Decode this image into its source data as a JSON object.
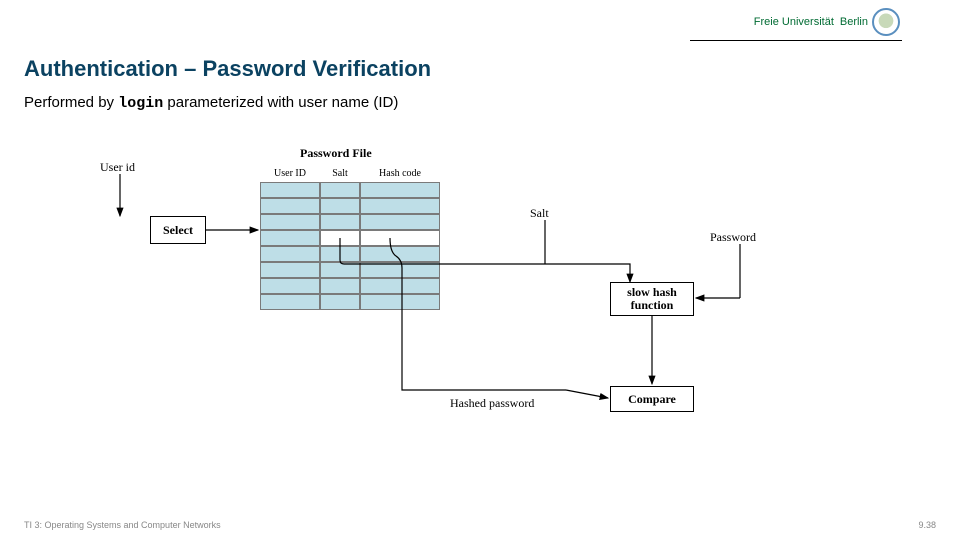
{
  "header": {
    "uni_line1": "Freie Universität",
    "uni_line2": "Berlin"
  },
  "title": "Authentication – Password Verification",
  "subtitle": {
    "pre": "Performed by ",
    "code": "login",
    "post": " parameterized with user name (ID)"
  },
  "diagram": {
    "labels": {
      "password_file": "Password File",
      "user_id": "User id",
      "col_user_id": "User ID",
      "col_salt": "Salt",
      "col_hash": "Hash code",
      "select": "Select",
      "salt": "Salt",
      "password": "Password",
      "slow_hash": "slow hash function",
      "hashed_password": "Hashed password",
      "compare": "Compare"
    },
    "table_rows": 8,
    "highlight_row_index": 3
  },
  "footer": {
    "left": "TI 3: Operating Systems and Computer Networks",
    "right": "9.38"
  }
}
